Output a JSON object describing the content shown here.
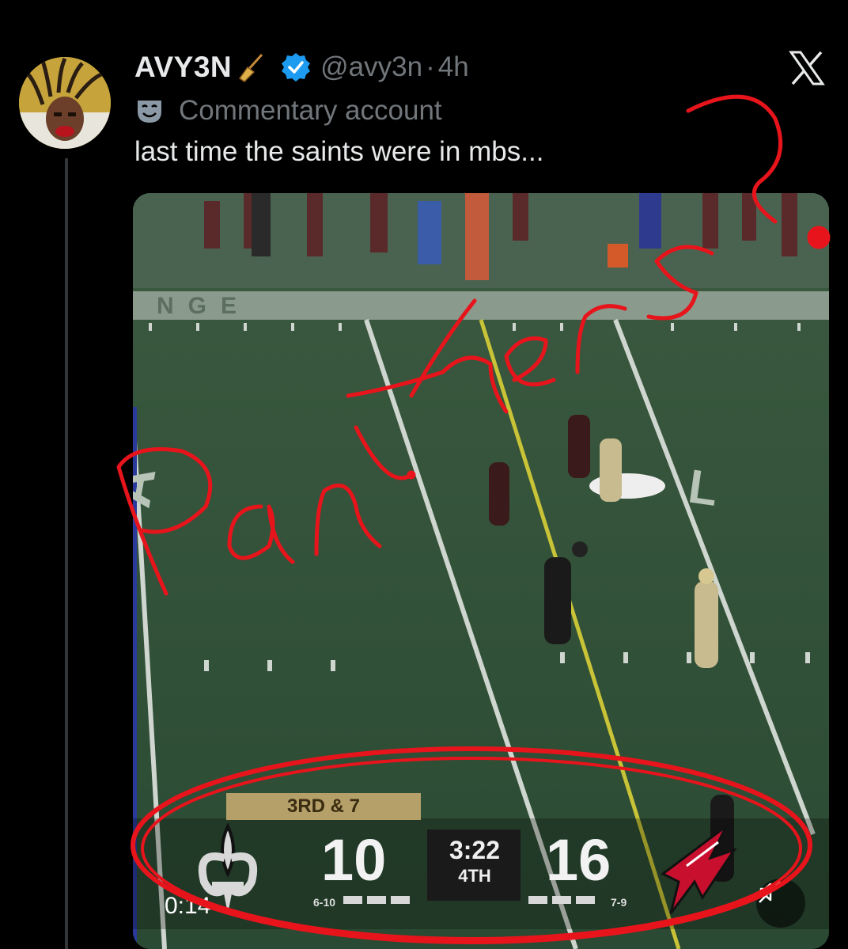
{
  "tweet": {
    "display_name": "AVY3N",
    "name_emoji": "broom-icon",
    "verified": true,
    "handle": "@avy3n",
    "separator": "·",
    "time": "4h",
    "label": "Commentary account",
    "label_icon": "theater-mask-icon",
    "text": "last time the saints were in mbs..."
  },
  "media": {
    "video_time": "0:14",
    "scoreboard": {
      "down_distance": "3RD & 7",
      "home_score": "10",
      "home_record": "6-10",
      "away_score": "16",
      "away_record": "7-9",
      "clock": "3:22",
      "quarter": "4TH"
    }
  },
  "annotations": {
    "handwriting": "panthers?",
    "color": "#e8141c"
  },
  "colors": {
    "background": "#000000",
    "primary_text": "#e7e9ea",
    "secondary_text": "#71767b",
    "verified_blue": "#1d9bf0"
  }
}
